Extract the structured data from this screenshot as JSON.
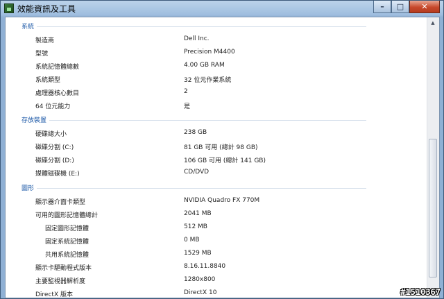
{
  "window": {
    "title": "效能資訊及工具"
  },
  "caption": {
    "minimize": "–",
    "maximize": "□",
    "close": "✕"
  },
  "sections": [
    {
      "header": "系統",
      "rows": [
        {
          "label": "製造商",
          "value": "Dell Inc."
        },
        {
          "label": "型號",
          "value": "Precision M4400"
        },
        {
          "label": "系統記憶體總數",
          "value": "4.00 GB RAM"
        },
        {
          "label": "系統類型",
          "value": "32 位元作業系統"
        },
        {
          "label": "處理器核心數目",
          "value": "2"
        },
        {
          "label": "64 位元能力",
          "value": "是"
        }
      ]
    },
    {
      "header": "存放裝置",
      "rows": [
        {
          "label": "硬碟總大小",
          "value": "238 GB"
        },
        {
          "label": "磁碟分割 (C:)",
          "value": "81 GB 可用 (總計 98 GB)"
        },
        {
          "label": "磁碟分割 (D:)",
          "value": "106 GB 可用 (總計 141 GB)"
        },
        {
          "label": "媒體磁碟機 (E:)",
          "value": "CD/DVD"
        }
      ]
    },
    {
      "header": "圖形",
      "rows": [
        {
          "label": "顯示器介面卡類型",
          "value": "NVIDIA Quadro FX 770M"
        },
        {
          "label": "可用的圖形記憶體總計",
          "value": "2041 MB"
        },
        {
          "label": "固定圖形記憶體",
          "value": "512 MB"
        },
        {
          "label": "固定系統記憶體",
          "value": "0 MB"
        },
        {
          "label": "共用系統記憶體",
          "value": "1529 MB"
        },
        {
          "label": "顯示卡驅動程式版本",
          "value": "8.16.11.8840"
        },
        {
          "label": "主要監視器解析度",
          "value": "1280x800"
        },
        {
          "label": "DirectX 版本",
          "value": "DirectX 10"
        }
      ]
    }
  ],
  "watermark": "#1510367"
}
